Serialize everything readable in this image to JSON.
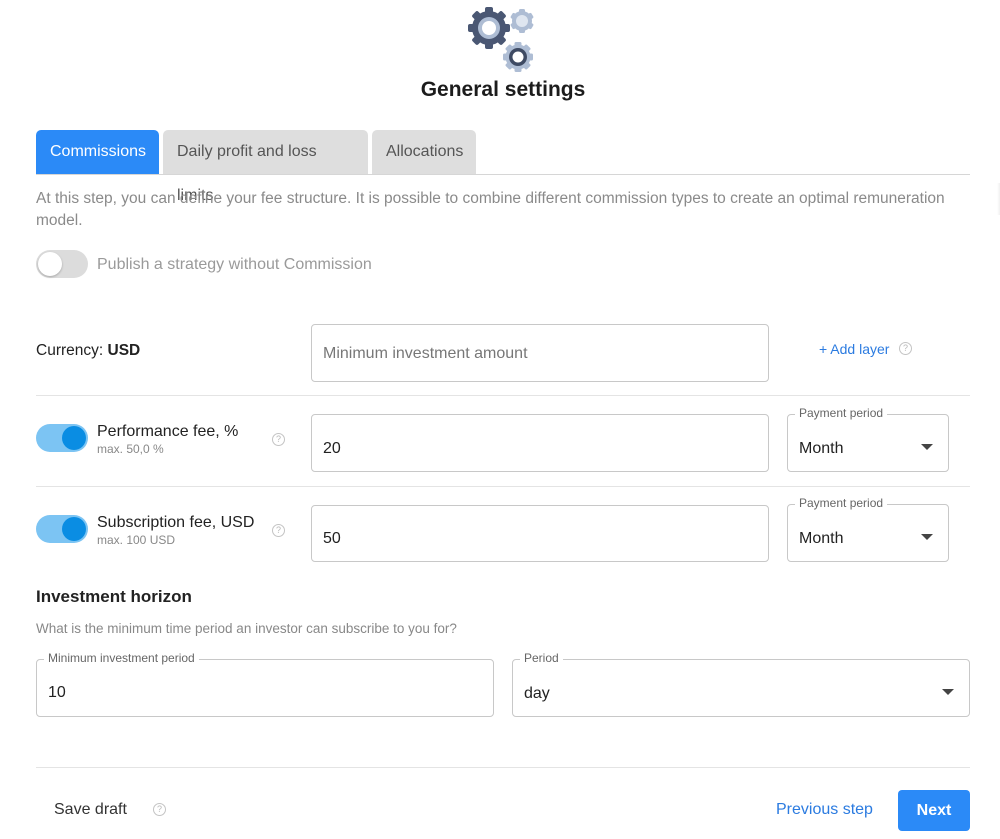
{
  "header": {
    "icon": "gears-icon",
    "title": "General settings"
  },
  "tabs": [
    {
      "label": "Commissions",
      "active": true
    },
    {
      "label": "Daily profit and loss limits",
      "active": false
    },
    {
      "label": "Allocations",
      "active": false
    }
  ],
  "intro": {
    "text": "At this step, you can define your fee structure. It is possible to combine different commission types to create an optimal remuneration model."
  },
  "publish_toggle": {
    "label": "Publish a strategy without Commission",
    "checked": false
  },
  "currency_row": {
    "label": "Currency:",
    "value": "USD",
    "min_investment_placeholder": "Minimum investment amount",
    "add_layer": "+ Add layer"
  },
  "performance_fee": {
    "enabled": true,
    "title": "Performance fee, %",
    "subtitle": "max. 50,0 %",
    "value": "20",
    "period_label": "Payment period",
    "period_value": "Month"
  },
  "subscription_fee": {
    "enabled": true,
    "title": "Subscription fee, USD",
    "subtitle": "max. 100 USD",
    "value": "50",
    "period_label": "Payment period",
    "period_value": "Month"
  },
  "investment_horizon": {
    "title": "Investment horizon",
    "description": "What is the minimum time period an investor can subscribe to you for?",
    "min_period_label": "Minimum investment period",
    "min_period_value": "10",
    "period_label": "Period",
    "period_value": "day"
  },
  "footer": {
    "save_draft": "Save draft",
    "previous_step": "Previous step",
    "next": "Next"
  },
  "help_glyph": "?",
  "colors": {
    "accent": "#2b8af7",
    "toggle_on_track": "#7cc4f3",
    "toggle_on_knob": "#0a8de3",
    "link": "#2b7be0"
  }
}
